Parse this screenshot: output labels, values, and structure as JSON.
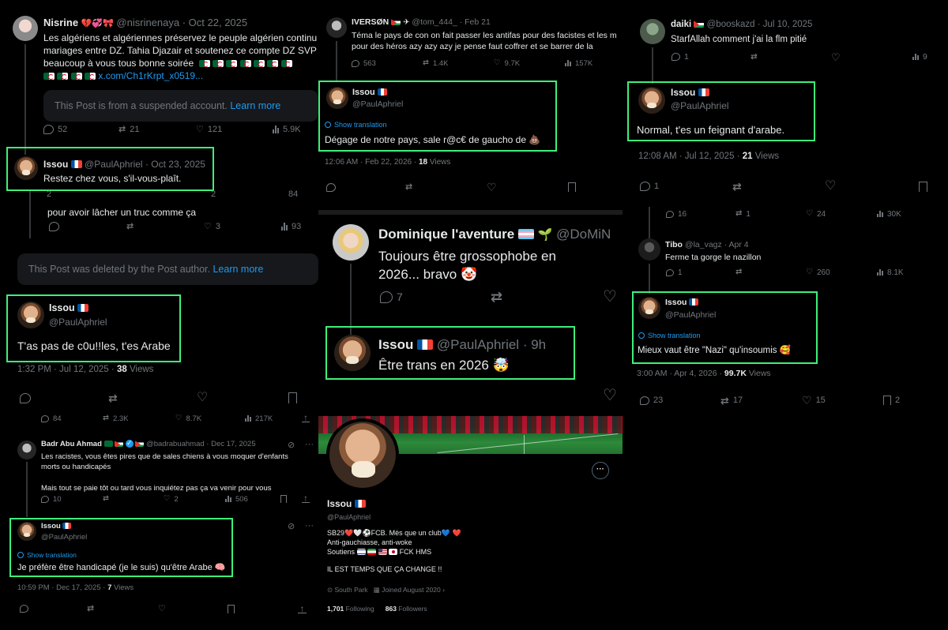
{
  "emoji": {
    "hearts": "💔💞🎀",
    "poop": "💩",
    "clown": "🤡",
    "exploding": "🤯",
    "brain": "🧠",
    "seedling": "🌱",
    "plane": "✈",
    "hug": "🥰",
    "bio_icons": "❤️🤍⚽",
    "blue_heart": "💙",
    "red_heart": "❤️"
  },
  "panel1": {
    "nisrine": {
      "name": "Nisrine",
      "handle": "@nisrinenaya",
      "date": "· Oct 22, 2025",
      "text_line1": "Les algériens et algériennes préservez le peuple algérien continu",
      "text_line2": "mariages entre DZ. Tahia Djazair et soutenez ce compte DZ SVP",
      "text_line3": "beaucoup à vous tous bonne soirée",
      "link": "x.com/Ch1rKrpt_x0519...",
      "notice": "This Post is from a suspended account.",
      "learn_more": "Learn more",
      "replies": "52",
      "reposts": "21",
      "likes": "121",
      "views": "5.9K"
    },
    "issou1": {
      "name": "Issou",
      "handle": "@PaulAphriel",
      "date": "· Oct 23, 2025",
      "text": "Restez chez vous, s'il-vous-plaît."
    },
    "partial": {
      "stat_a": "2",
      "stat_b": "2",
      "stat_c": "84",
      "text": "pour avoir lâcher un truc comme ça",
      "likes": "3",
      "views": "93"
    },
    "deleted": {
      "notice": "This Post was deleted by the Post author.",
      "learn_more": "Learn more"
    },
    "issou2": {
      "name": "Issou",
      "handle": "@PaulAphriel",
      "text": "T'as pas de c0u!!les, t'es Arabe",
      "time": "1:32 PM · Jul 12, 2025 ·",
      "views_count": "38",
      "views_label": "Views"
    },
    "issou2_stats": {
      "replies": "84",
      "reposts": "2.3K",
      "likes": "8.7K",
      "views": "217K"
    },
    "badr": {
      "name": "Badr Abu Ahmad",
      "handle": "@badrabuahmad",
      "date": "· Dec 17, 2025",
      "text_line1": "Les racistes, vous êtes pires que de sales chiens à vous moquer d'enfants",
      "text_line2": "morts ou handicapés",
      "text_line3": "Mais tout se paie tôt ou tard vous inquiétez pas ça va venir pour vous",
      "replies": "10",
      "likes": "2",
      "views": "506"
    },
    "issou3": {
      "name": "Issou",
      "handle": "@PaulAphriel",
      "show_translation": "Show translation",
      "text": "Je préfère être handicapé (je le suis) qu'être Arabe",
      "time": "10:59 PM · Dec 17, 2025 ·",
      "views_count": "7",
      "views_label": "Views"
    }
  },
  "panel2": {
    "iverson": {
      "name": "IVERSØN",
      "handle": "@tom_444_",
      "date": "· Feb 21",
      "text_line1": "Téma le pays de con on fait passer les antifas pour des facistes et les m",
      "text_line2": "pour des héros azy azy azy je pense faut coffrer et se barrer de la",
      "replies": "563",
      "reposts": "1.4K",
      "likes": "9.7K",
      "views": "157K"
    },
    "issou4": {
      "name": "Issou",
      "handle": "@PaulAphriel",
      "show_translation": "Show translation",
      "text": "Dégage de notre pays, sale r@c€ de gaucho de",
      "time": "12:06 AM · Feb 22, 2026 ·",
      "views_count": "18",
      "views_label": "Views"
    },
    "dominique": {
      "name": "Dominique l'aventure",
      "handle": "@DoMiN",
      "text_line1": "Toujours être grossophobe en",
      "text_line2": "2026... bravo",
      "replies": "7"
    },
    "issou5": {
      "name": "Issou",
      "handle": "@PaulAphriel",
      "date": "· 9h",
      "text": "Être trans en 2026"
    },
    "profile": {
      "name": "Issou",
      "handle": "@PaulAphriel",
      "bio_line1a": "SB29",
      "bio_line1b": "FCB. Mès que un club",
      "bio_line2": "Anti-gauchiasse, anti-woke",
      "bio_line3a": "Soutiens",
      "bio_line3b": "FCK HMS",
      "bio_line4": "IL EST TEMPS QUE ÇA CHANGE !!",
      "location": "South Park",
      "joined": "Joined August 2020",
      "following_count": "1,701",
      "following_label": "Following",
      "followers_count": "863",
      "followers_label": "Followers",
      "more_button": "···"
    }
  },
  "panel3": {
    "daiki": {
      "name": "daiki",
      "handle": "@booskazd",
      "date": "· Jul 10, 2025",
      "text": "StarfAllah comment j'ai la flm pitié",
      "replies": "1",
      "views": "9"
    },
    "issou6": {
      "name": "Issou",
      "handle": "@PaulAphriel",
      "text": "Normal, t'es un feignant d'arabe.",
      "time": "12:08 AM · Jul 12, 2025 ·",
      "views_count": "21",
      "views_label": "Views",
      "replies": "1"
    },
    "partial": {
      "replies": "16",
      "reposts": "1",
      "likes": "24",
      "views": "30K"
    },
    "tibo": {
      "name": "Tibo",
      "handle": "@la_vagz",
      "date": "· Apr 4",
      "text": "Ferme ta gorge le nazillon",
      "replies": "1",
      "likes": "260",
      "views": "8.1K"
    },
    "issou7": {
      "name": "Issou",
      "handle": "@PaulAphriel",
      "show_translation": "Show translation",
      "text": "Mieux vaut être \"Nazi\" qu'insoumis",
      "time": "3:00 AM · Apr 4, 2026 ·",
      "views_count": "99.7K",
      "views_label": "Views"
    },
    "issou7_stats": {
      "replies": "23",
      "reposts": "17",
      "likes": "15",
      "bookmarks": "2"
    }
  },
  "colors": {
    "highlight": "#3ef07a",
    "link": "#1d9bf0",
    "muted": "#71767b",
    "text": "#e7e9ea",
    "background": "#000000"
  }
}
